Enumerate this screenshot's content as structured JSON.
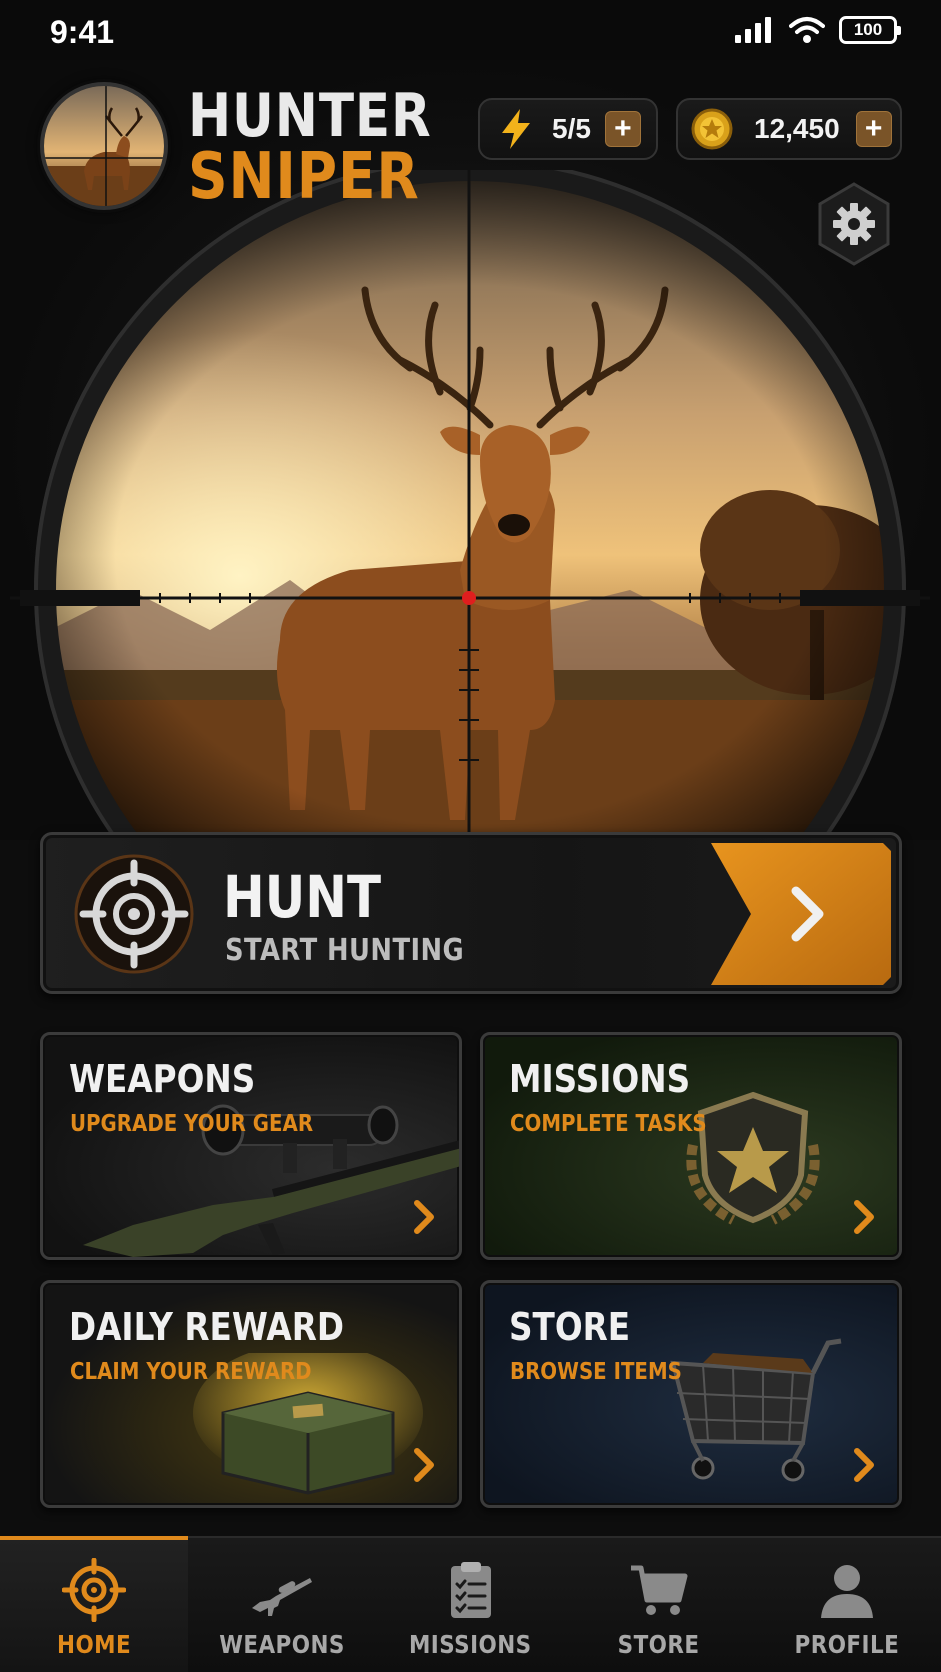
{
  "status": {
    "time": "9:41",
    "battery": "100"
  },
  "app": {
    "title_line1": "HUNTER",
    "title_line2": "SNIPER"
  },
  "resources": {
    "energy": {
      "value": "5/5",
      "icon": "lightning-icon"
    },
    "coins": {
      "value": "12,450",
      "icon": "coin-icon"
    },
    "plus_label": "+"
  },
  "hunt": {
    "title": "HUNT",
    "subtitle": "START HUNTING"
  },
  "tiles": [
    {
      "title": "WEAPONS",
      "subtitle": "UPGRADE YOUR GEAR"
    },
    {
      "title": "MISSIONS",
      "subtitle": "COMPLETE TASKS"
    },
    {
      "title": "DAILY REWARD",
      "subtitle": "CLAIM YOUR REWARD"
    },
    {
      "title": "STORE",
      "subtitle": "BROWSE ITEMS"
    }
  ],
  "tabs": [
    {
      "label": "HOME",
      "icon": "crosshair-icon",
      "active": true
    },
    {
      "label": "WEAPONS",
      "icon": "rifle-icon",
      "active": false
    },
    {
      "label": "MISSIONS",
      "icon": "clipboard-icon",
      "active": false
    },
    {
      "label": "STORE",
      "icon": "cart-icon",
      "active": false
    },
    {
      "label": "PROFILE",
      "icon": "person-icon",
      "active": false
    }
  ],
  "colors": {
    "accent": "#e08a1c",
    "background": "#0d0d0d"
  }
}
